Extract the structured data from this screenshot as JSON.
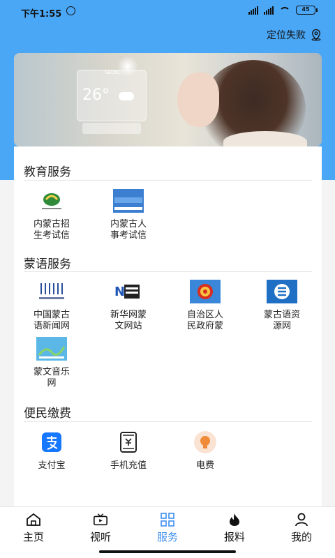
{
  "status_bar": {
    "time": "下午1:55",
    "battery": "45"
  },
  "header": {
    "location_text": "定位失败"
  },
  "sections": {
    "education": {
      "title": "教育服务",
      "items": [
        {
          "label_line1": "内蒙古招",
          "label_line2": "生考试信",
          "icon": "zhaosheng-logo-icon"
        },
        {
          "label_line1": "内蒙古人",
          "label_line2": "事考试信",
          "icon": "renshi-exam-banner-icon"
        }
      ]
    },
    "mongolian": {
      "title": "蒙语服务",
      "items": [
        {
          "label_line1": "中国蒙古",
          "label_line2": "语新闻网",
          "icon": "mongolian-news-logo-icon"
        },
        {
          "label_line1": "新华网蒙",
          "label_line2": "文网站",
          "icon": "xinhua-news-logo-icon"
        },
        {
          "label_line1": "自治区人",
          "label_line2": "民政府蒙",
          "icon": "national-emblem-icon"
        },
        {
          "label_line1": "蒙古语资",
          "label_line2": "源网",
          "icon": "mongolian-resource-logo-icon"
        },
        {
          "label_line1": "蒙文音乐",
          "label_line2": "网",
          "icon": "mongolian-music-logo-icon"
        }
      ]
    },
    "payment": {
      "title": "便民缴费",
      "items": [
        {
          "label": "支付宝",
          "icon": "alipay-icon"
        },
        {
          "label": "手机充值",
          "icon": "phone-recharge-icon"
        },
        {
          "label": "电费",
          "icon": "lightbulb-icon"
        }
      ]
    }
  },
  "nav": {
    "items": [
      {
        "label": "主页",
        "icon": "home-icon"
      },
      {
        "label": "视听",
        "icon": "tv-icon"
      },
      {
        "label": "服务",
        "icon": "grid-icon"
      },
      {
        "label": "报料",
        "icon": "fire-icon"
      },
      {
        "label": "我的",
        "icon": "person-icon"
      }
    ],
    "active": "服务"
  },
  "colors": {
    "header_blue": "#4aa7f6",
    "active_nav": "#3d8ef0",
    "alipay_blue": "#1677ff",
    "bulb_orange": "#f08b3a"
  }
}
